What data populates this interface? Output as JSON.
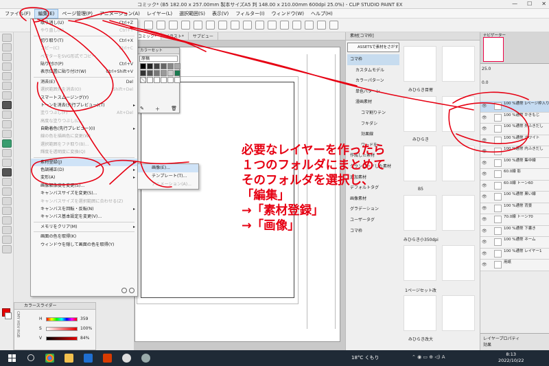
{
  "window": {
    "title": "コミック* (B5 182.00 x 257.00mm 製本サイズA5 判 148.00 x 210.00mm 600dpi 25.0%) - CLIP STUDIO PAINT EX",
    "min": "—",
    "max": "☐",
    "close": "✕"
  },
  "menubar": [
    "ファイル(F)",
    "編集(E)",
    "ページ管理(P)",
    "アニメーション(A)",
    "レイヤー(L)",
    "選択範囲(S)",
    "表示(V)",
    "フィルター(I)",
    "ウィンドウ(W)",
    "ヘルプ(H)"
  ],
  "canvas_tabs": [
    "コミック*",
    "イラスト*",
    "サブビュー"
  ],
  "color_set": {
    "title": "カラーセット",
    "preset": "原稿"
  },
  "edit_menu": [
    {
      "label": "取り消し(U)",
      "shortcut": "Ctrl+Z",
      "state": "normal"
    },
    {
      "label": "やり直し(R)",
      "shortcut": "Ctrl+Y",
      "state": "disabled"
    },
    {
      "sep": true
    },
    {
      "label": "切り取り(T)",
      "shortcut": "Ctrl+X",
      "state": "normal"
    },
    {
      "label": "コピー(C)",
      "shortcut": "Ctrl+C",
      "state": "disabled"
    },
    {
      "label": "ベクターをSVG形式でコピー",
      "shortcut": "",
      "state": "disabled"
    },
    {
      "label": "貼り付け(P)",
      "shortcut": "Ctrl+V",
      "state": "normal"
    },
    {
      "label": "表示位置に貼り付け(W)",
      "shortcut": "Ctrl+Shift+V",
      "state": "normal"
    },
    {
      "sep": true
    },
    {
      "label": "消去(E)",
      "shortcut": "Del",
      "state": "normal"
    },
    {
      "label": "選択範囲外を消去(O)",
      "shortcut": "Shift+Del",
      "state": "disabled"
    },
    {
      "label": "スマートスムージング(Y)",
      "shortcut": "",
      "state": "normal"
    },
    {
      "label": "トーンを消去(先行プレビュー)(T)",
      "shortcut": "▸",
      "state": "normal"
    },
    {
      "label": "塗りつぶし(F)",
      "shortcut": "Alt+Del",
      "state": "disabled"
    },
    {
      "label": "高度な塗りつぶし(L)...",
      "shortcut": "",
      "state": "disabled"
    },
    {
      "label": "自動着色(先行プレビュー)(I)",
      "shortcut": "▸",
      "state": "normal"
    },
    {
      "label": "線の色を描画色に変更(W)",
      "shortcut": "",
      "state": "disabled"
    },
    {
      "label": "選択範囲をフチ取り(B)...",
      "shortcut": "",
      "state": "disabled"
    },
    {
      "label": "輝度を透明度に変換(Q)",
      "shortcut": "",
      "state": "disabled"
    },
    {
      "sep": true
    },
    {
      "label": "素材登録(J)",
      "shortcut": "▸",
      "state": "highlight"
    },
    {
      "label": "色調補正(D)",
      "shortcut": "▸",
      "state": "normal"
    },
    {
      "label": "変形(A)",
      "shortcut": "▸",
      "state": "normal"
    },
    {
      "label": "画像解像度を変更(S)...",
      "shortcut": "",
      "state": "normal"
    },
    {
      "label": "キャンバスサイズを変更(S)...",
      "shortcut": "",
      "state": "normal"
    },
    {
      "label": "キャンバスサイズを選択範囲に合わせる(Z)",
      "shortcut": "",
      "state": "disabled"
    },
    {
      "label": "キャンバスを回転・反転(N)",
      "shortcut": "▸",
      "state": "normal"
    },
    {
      "label": "キャンバス基本設定を変更(V)...",
      "shortcut": "",
      "state": "normal"
    },
    {
      "sep": true
    },
    {
      "label": "メモリをクリア(M)",
      "shortcut": "▸",
      "state": "normal"
    },
    {
      "sep": true
    },
    {
      "label": "画面の色を取得(K)",
      "shortcut": "",
      "state": "normal"
    },
    {
      "label": "ウィンドウを隠して画面の色を取得(Y)",
      "shortcut": "",
      "state": "normal"
    }
  ],
  "submenu": [
    {
      "label": "画像(E)...",
      "state": "highlight"
    },
    {
      "label": "テンプレート(T)...",
      "state": "normal"
    },
    {
      "label": "アニメーション(A)...",
      "state": "disabled"
    }
  ],
  "color_slider": {
    "title": "カラースライダー",
    "modes": "CMY HSV RGB",
    "rows": [
      {
        "label": "H",
        "value": "359",
        "color": "#e50000"
      },
      {
        "label": "S",
        "value": "100%",
        "color": "#e50000"
      },
      {
        "label": "V",
        "value": "84%",
        "color": "#a00000"
      }
    ]
  },
  "material": {
    "title": "素材[コマ枠]",
    "assets_button": "ASSETSで素材をさがす",
    "tree": [
      "コマ枠",
      "カスタムモデル",
      "カラーパターン",
      "単色パターン",
      "漫画素材",
      "コマ割りテン",
      "フキダシ",
      "効果線",
      "ワードを...",
      "作成した素材",
      "ダウンロードした素材",
      "追加素材",
      "デフォルトタグ",
      "画像素材",
      "グラデーション",
      "ユーザータグ",
      "コマ枠"
    ],
    "captions": [
      "みひらき目寄",
      "みひらき",
      "B5",
      "みひらき小350dpi",
      "1ページセット改",
      "みひらき改大"
    ]
  },
  "navigator": {
    "title": "ナビゲーター",
    "zoom": "25.0",
    "angle": "0.0"
  },
  "layers": [
    {
      "name": "100 %通常 1ページ枠入り",
      "selected": true
    },
    {
      "name": "100 %通常 かきもじ"
    },
    {
      "name": "100 %通常 外ふきだし"
    },
    {
      "name": "100 %通常 ホワイト"
    },
    {
      "name": "100 %通常 内ふきだし"
    },
    {
      "name": "100 %通常 集中線"
    },
    {
      "name": "60.0線 影"
    },
    {
      "name": "60.0線 トーン60"
    },
    {
      "name": "100 %通常 黒い線"
    },
    {
      "name": "100 %通常 背景"
    },
    {
      "name": "70.0線 トーン70"
    },
    {
      "name": "100 %通常 下書き"
    },
    {
      "name": "100 %通常 ネーム"
    },
    {
      "name": "100 %通常 レイヤー1"
    },
    {
      "name": "用紙"
    }
  ],
  "layer_property": {
    "title": "レイヤープロパティ",
    "effect": "効果"
  },
  "annotation": [
    "必要なレイヤーを作ったら",
    "１つのフォルダにまとめて",
    "そのフォルダを選択し、",
    "「編集」",
    "→「素材登録」",
    "→「画像」"
  ],
  "taskbar": {
    "weather": "18°C くもり",
    "time": "8:13",
    "date": "2022/10/22",
    "ime": "A"
  },
  "colors": {
    "accent_red": "#e60012",
    "highlight": "#cfe3f7"
  }
}
